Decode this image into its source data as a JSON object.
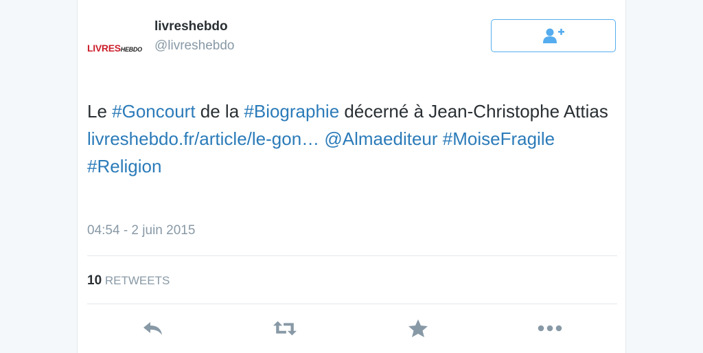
{
  "author": {
    "logo_main": "LIVRES",
    "logo_sub": "HEBDO",
    "display_name": "livreshebdo",
    "handle": "@livreshebdo"
  },
  "follow_button": {
    "icon": "add-user-icon"
  },
  "tweet": {
    "segments": [
      {
        "text": "Le ",
        "type": "text"
      },
      {
        "text": "#Goncourt",
        "type": "hashtag"
      },
      {
        "text": " de la ",
        "type": "text"
      },
      {
        "text": "#Biographie",
        "type": "hashtag"
      },
      {
        "text": " décerné à Jean-Christophe Attias",
        "type": "text"
      },
      {
        "text": "livreshebdo.fr/article/le-gon…",
        "type": "url"
      },
      {
        "text": " ",
        "type": "text"
      },
      {
        "text": "@Almaediteur",
        "type": "mention"
      },
      {
        "text": " ",
        "type": "text"
      },
      {
        "text": "#MoiseFragile",
        "type": "hashtag"
      },
      {
        "text": "#Religion",
        "type": "hashtag"
      }
    ],
    "timestamp": "04:54 - 2 juin 2015"
  },
  "stats": {
    "retweet_count": "10",
    "retweet_label": "RETWEETS"
  },
  "actions": [
    {
      "name": "reply-icon"
    },
    {
      "name": "retweet-icon"
    },
    {
      "name": "favorite-star-icon"
    },
    {
      "name": "more-options-icon"
    }
  ],
  "colors": {
    "link": "#2b7bb9",
    "icon_gray": "#8899a6",
    "brand_red": "#cc1f2b",
    "follow_border": "#55acee"
  }
}
